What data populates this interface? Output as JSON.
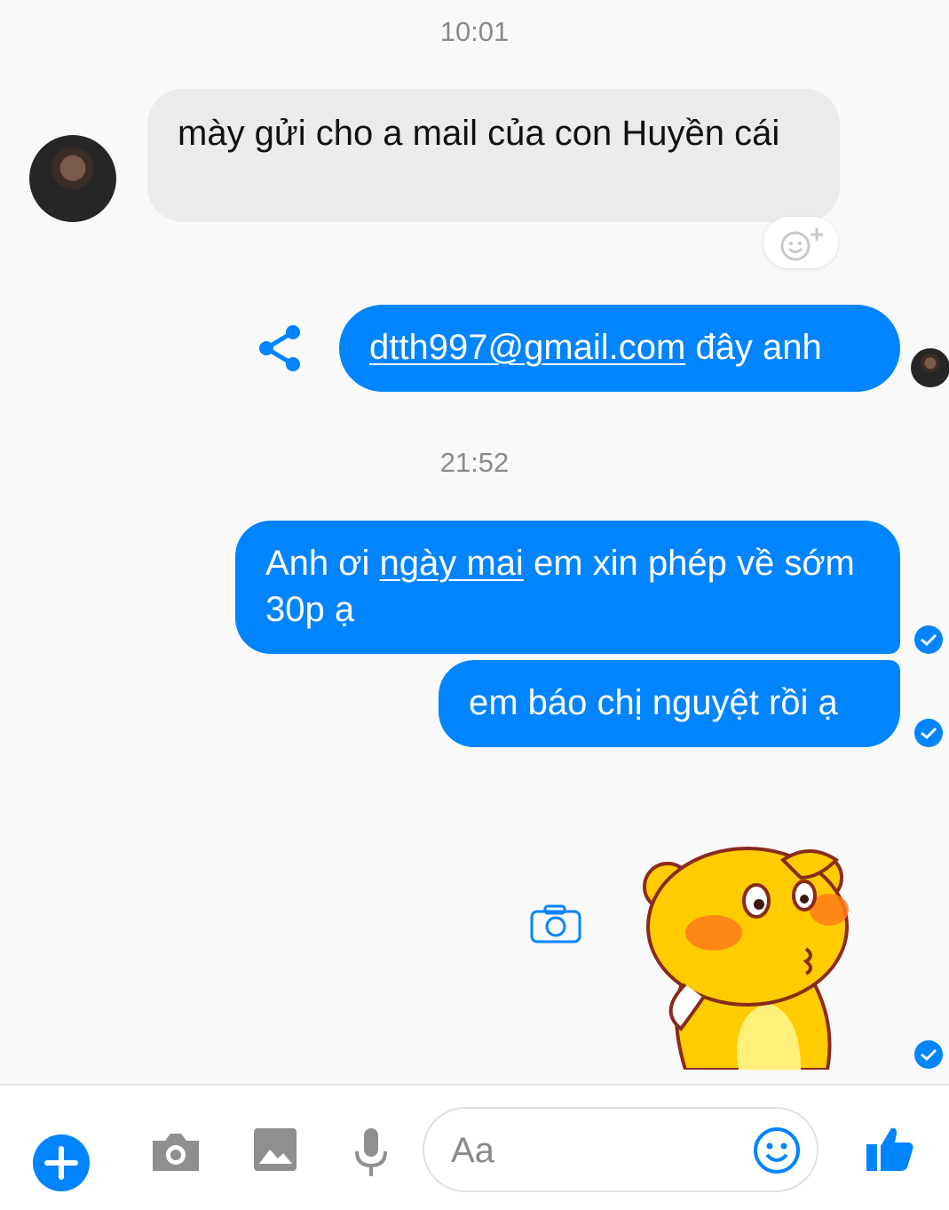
{
  "timestamps": [
    "10:01",
    "21:52"
  ],
  "messages": {
    "incoming_1": "mày gửi cho a mail của con Huyền cái",
    "outgoing_email_link": "dtth997@gmail.com",
    "outgoing_email_rest": " đây anh",
    "outgoing_2_pre": "Anh ơi ",
    "outgoing_2_link": "ngày mai",
    "outgoing_2_post": " em xin phép về sớm 30p ạ",
    "outgoing_3": "em báo chị nguyệt rồi ạ"
  },
  "composer": {
    "placeholder": "Aa"
  },
  "colors": {
    "accent": "#0084ff",
    "incoming_bubble": "#ebebeb",
    "background": "#f9f9f9",
    "sticker_yellow": "#ffcc00"
  },
  "icons": [
    "plus-circle-icon",
    "camera-icon",
    "image-icon",
    "microphone-icon",
    "emoji-icon",
    "thumbs-up-icon",
    "share-icon",
    "add-reaction-icon",
    "seen-check-icon"
  ]
}
